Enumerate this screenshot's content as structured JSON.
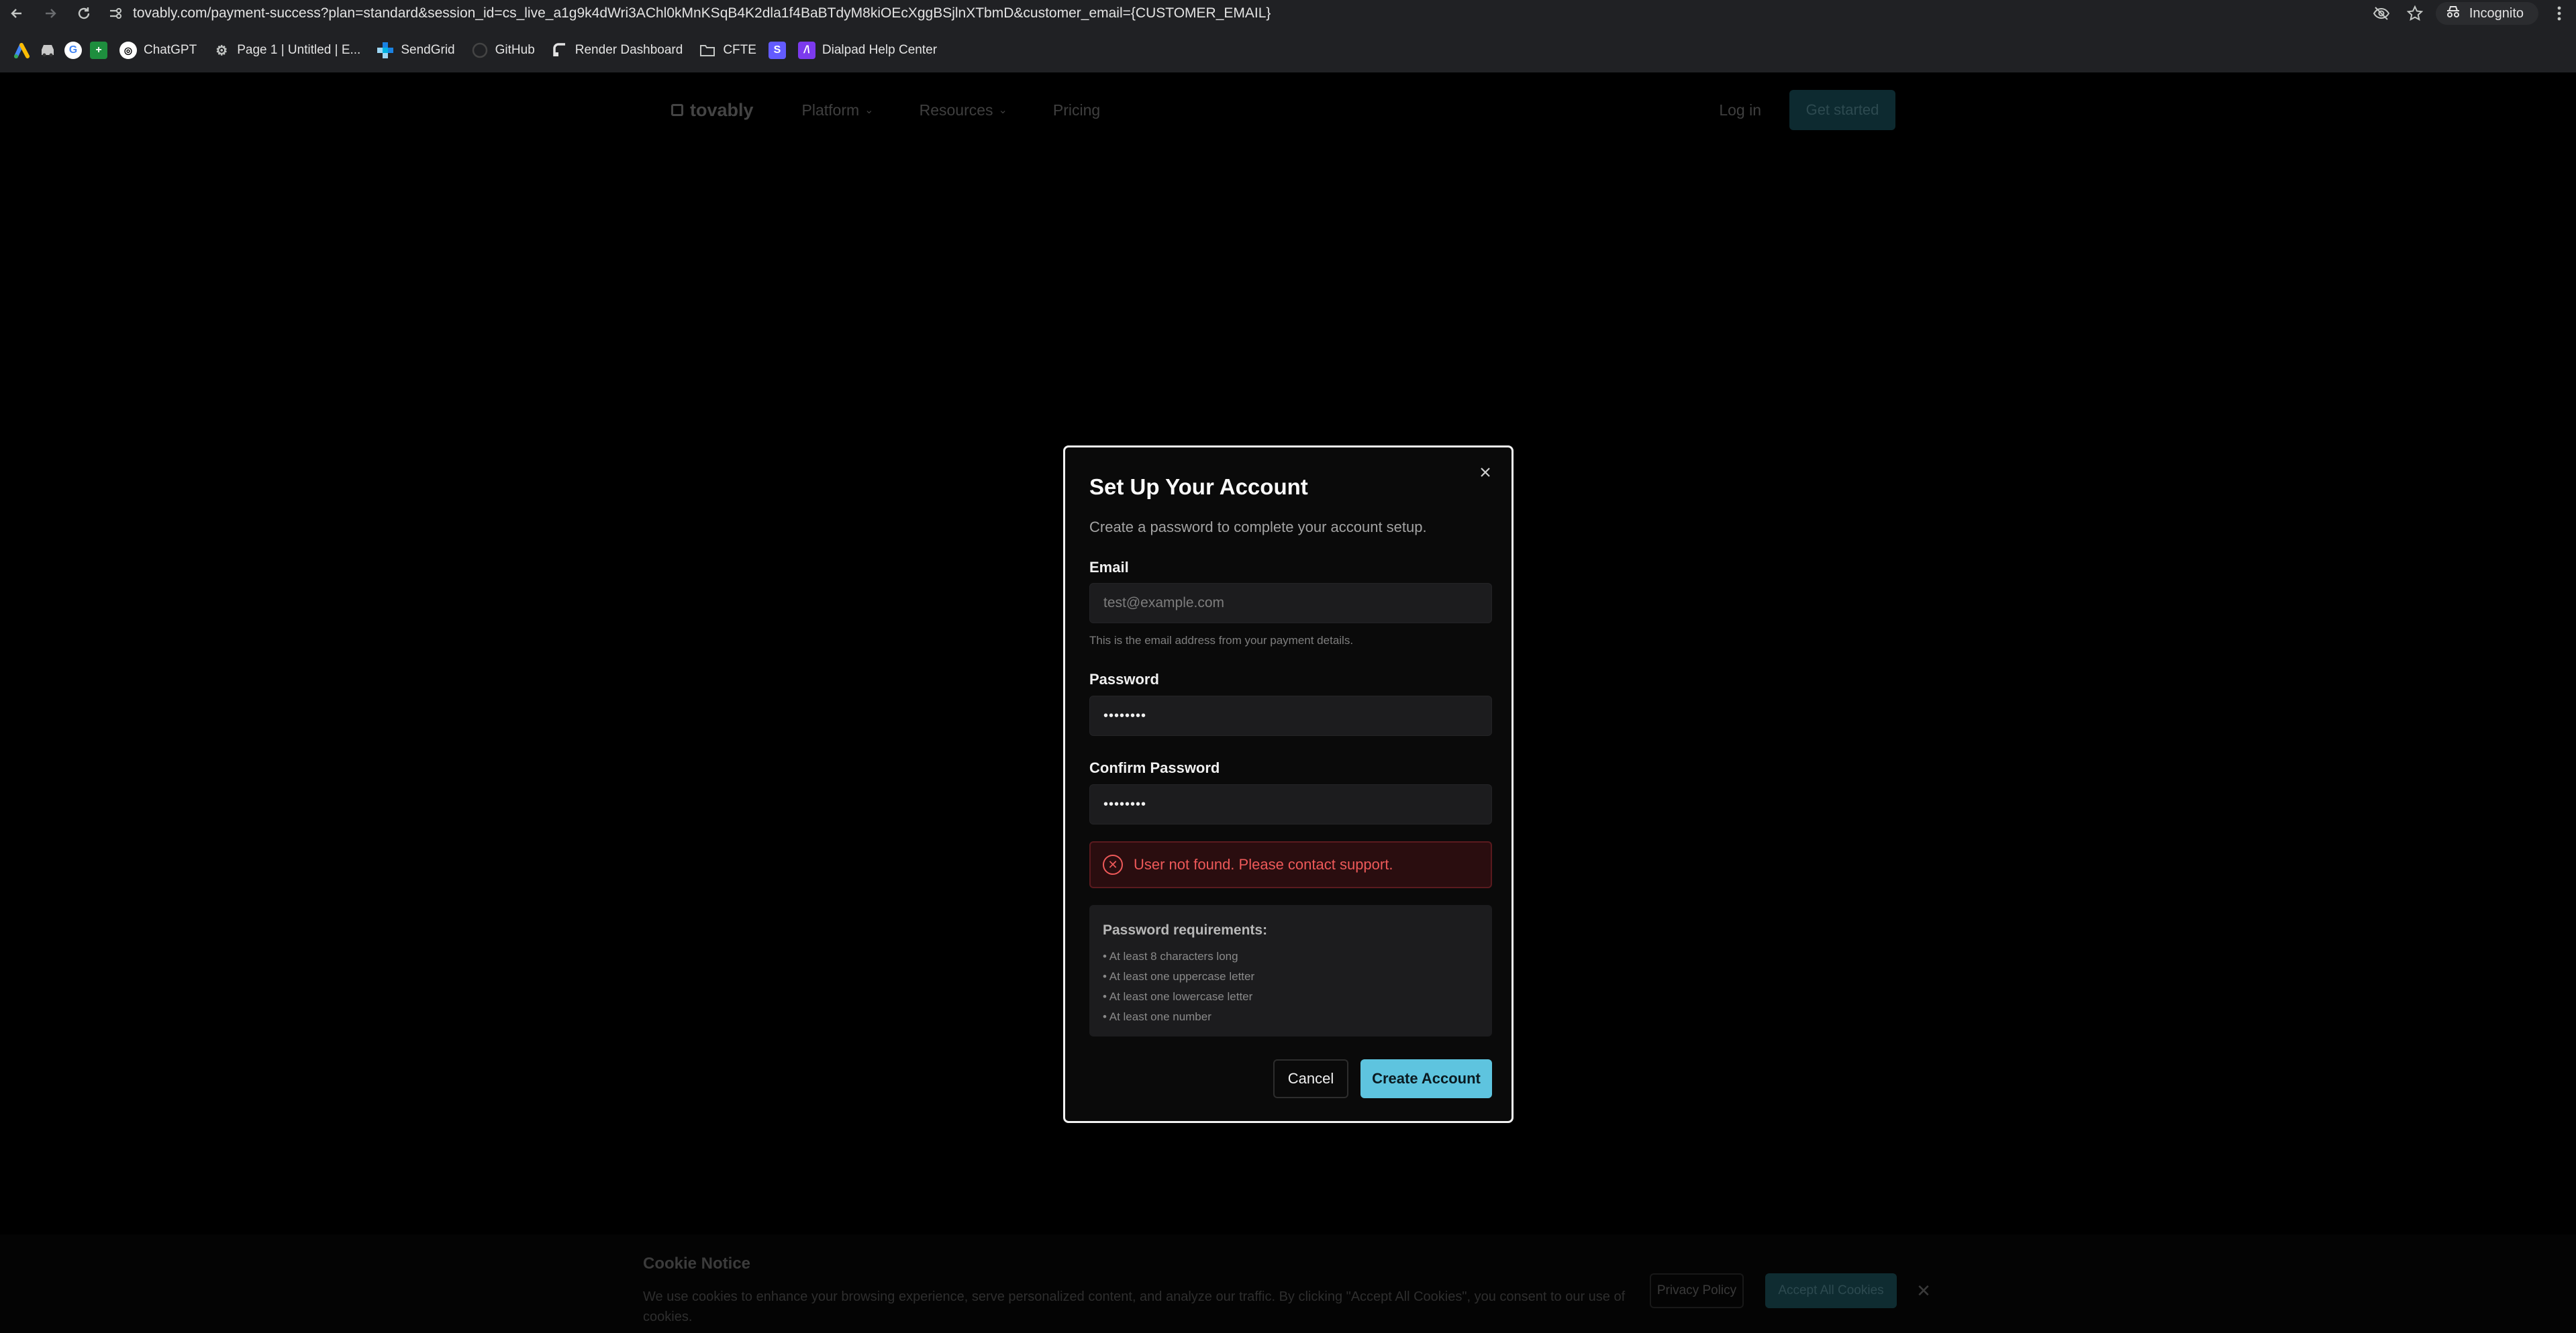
{
  "browser": {
    "url": "tovably.com/payment-success?plan=standard&session_id=cs_live_a1g9k4dWri3AChl0kMnKSqB4K2dla1f4BaBTdyM8kiOEcXggBSjlnXTbmD&customer_email={CUSTOMER_EMAIL}",
    "incognito_label": "Incognito",
    "bookmarks": [
      {
        "label": "ChatGPT",
        "icon": "chatgpt-icon"
      },
      {
        "label": "Page 1 | Untitled | E...",
        "icon": "page-icon"
      },
      {
        "label": "SendGrid",
        "icon": "sendgrid-icon"
      },
      {
        "label": "GitHub",
        "icon": "github-icon"
      },
      {
        "label": "Render Dashboard",
        "icon": "render-icon"
      },
      {
        "label": "CFTE",
        "icon": "folder-icon"
      },
      {
        "label": "",
        "icon": "s-icon"
      },
      {
        "label": "Dialpad Help Center",
        "icon": "dialpad-icon"
      }
    ]
  },
  "site": {
    "brand": "tovably",
    "nav": [
      "Platform",
      "Resources",
      "Pricing"
    ],
    "login": "Log in",
    "get_started": "Get started"
  },
  "modal": {
    "title": "Set Up Your Account",
    "subtitle": "Create a password to complete your account setup.",
    "email_label": "Email",
    "email_placeholder": "test@example.com",
    "email_help": "This is the email address from your payment details.",
    "password_label": "Password",
    "password_value": "••••••••",
    "confirm_label": "Confirm Password",
    "confirm_value": "••••••••",
    "error": "User not found. Please contact support.",
    "requirements_title": "Password requirements:",
    "requirements": [
      "• At least 8 characters long",
      "• At least one uppercase letter",
      "• At least one lowercase letter",
      "• At least one number"
    ],
    "cancel": "Cancel",
    "create": "Create Account"
  },
  "cookie": {
    "title": "Cookie Notice",
    "text": "We use cookies to enhance your browsing experience, serve personalized content, and analyze our traffic. By clicking \"Accept All Cookies\", you consent to our use of cookies.",
    "privacy": "Privacy Policy",
    "accept": "Accept All Cookies"
  },
  "colors": {
    "accent": "#5ec4df",
    "error": "#ee5959",
    "background": "#000000"
  }
}
